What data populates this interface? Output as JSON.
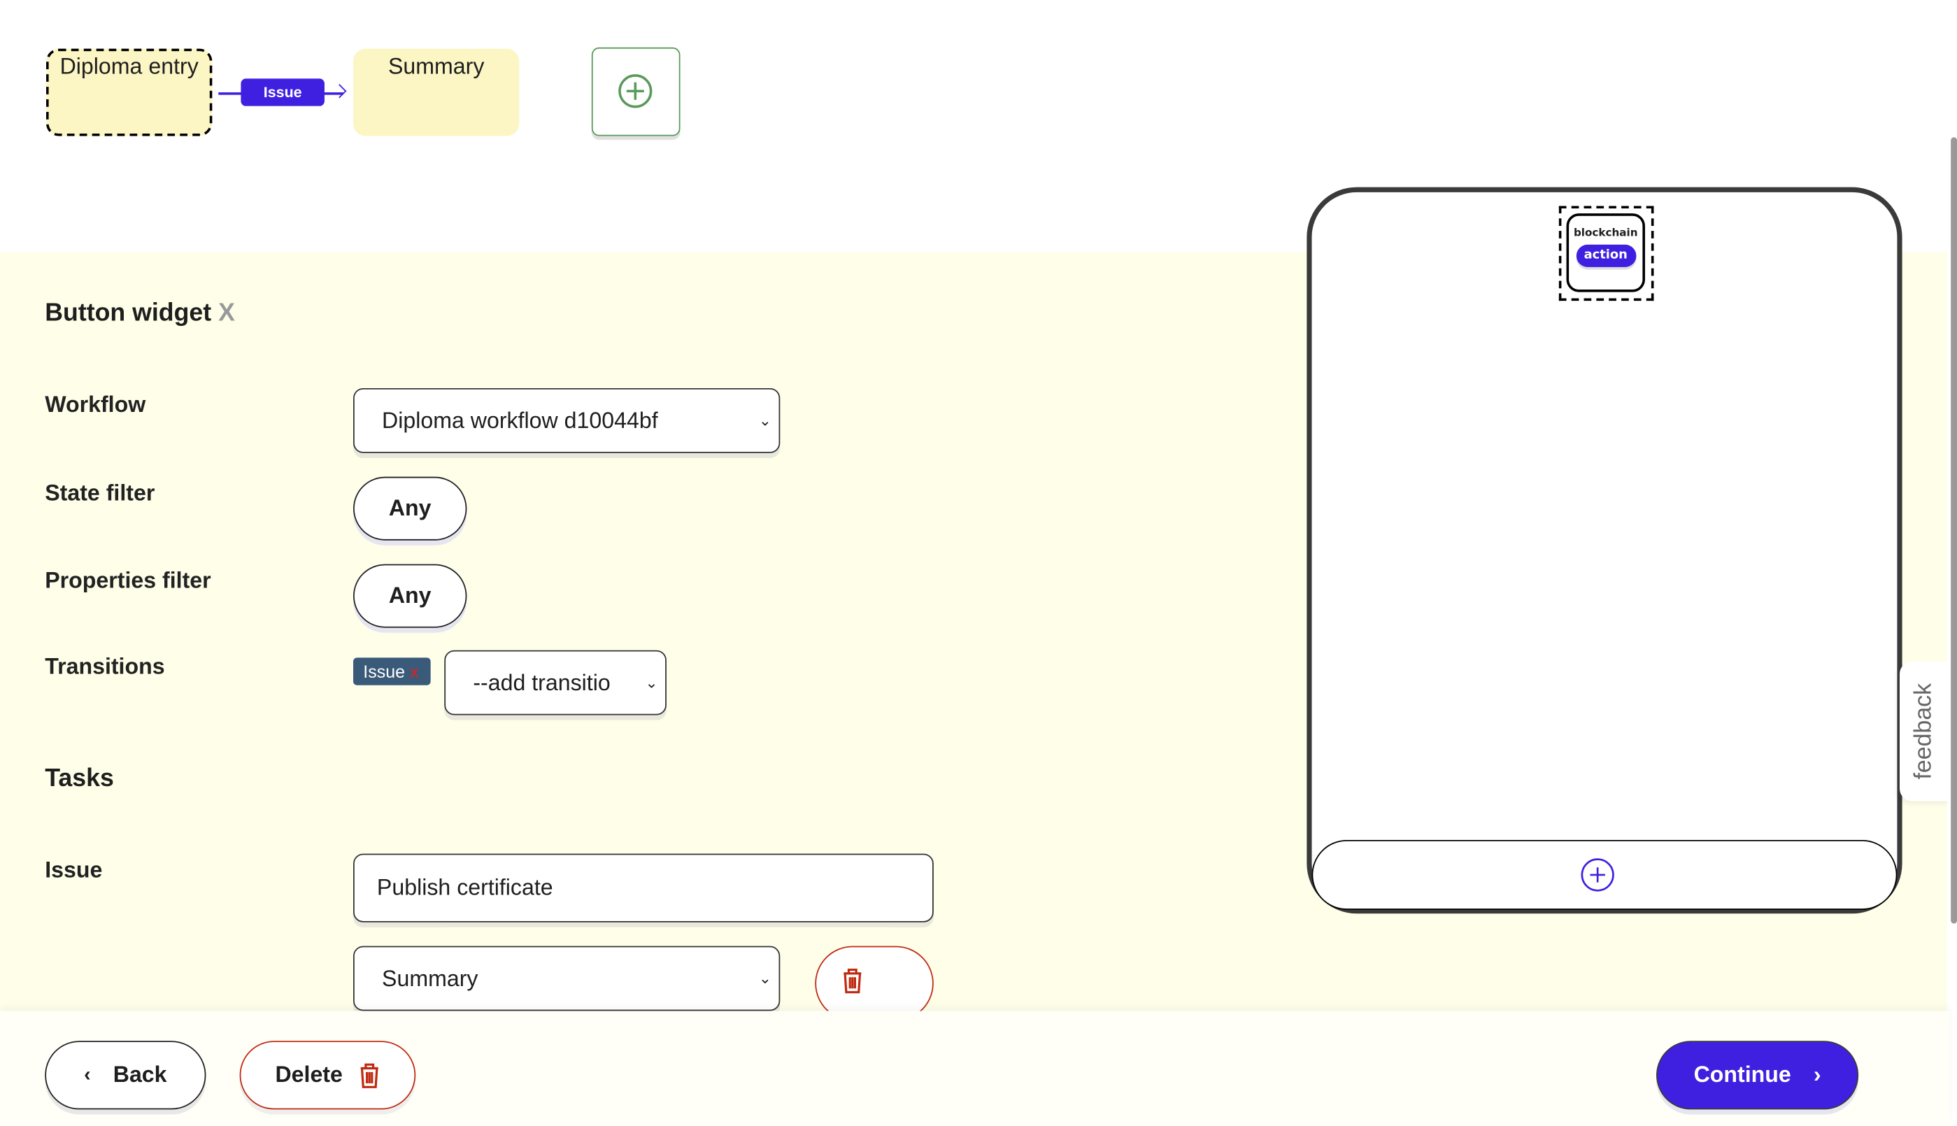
{
  "flow": {
    "nodes": [
      {
        "label": "Diploma entry",
        "selected": true
      },
      {
        "label": "Summary",
        "selected": false
      }
    ],
    "transition_label": "Issue",
    "add_state_icon": "plus-circle-icon"
  },
  "widget": {
    "title": "Button widget",
    "close_label": "X",
    "workflow_label": "Workflow",
    "workflow_value": "Diploma workflow d10044bf",
    "state_filter_label": "State filter",
    "state_filter_value": "Any",
    "properties_filter_label": "Properties filter",
    "properties_filter_value": "Any",
    "transitions_label": "Transitions",
    "transition_tag": "Issue",
    "transition_tag_remove": "x",
    "add_transition_placeholder": "--add transitio",
    "tasks_heading": "Tasks",
    "task_label": "Issue",
    "task_name_value": "Publish certificate",
    "task_target_value": "Summary"
  },
  "preview": {
    "widget_top": "blockchain",
    "widget_button": "action",
    "add_icon": "plus-circle-icon"
  },
  "feedback_label": "feedback",
  "footer": {
    "back_label": "Back",
    "delete_label": "Delete",
    "continue_label": "Continue"
  },
  "colors": {
    "accent": "#4020e0",
    "node_bg": "#fcf6c4",
    "panel_bg": "#fefee9",
    "danger": "#c02a10",
    "add_green": "#5a9a5a",
    "tag_bg": "#3a5a7a"
  }
}
